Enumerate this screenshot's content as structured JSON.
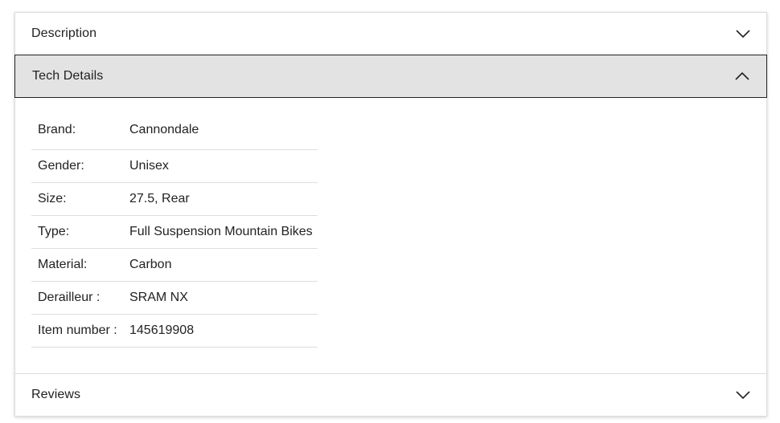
{
  "sections": {
    "description": {
      "title": "Description",
      "expanded": false,
      "icon": "chevron-down-icon"
    },
    "tech_details": {
      "title": "Tech Details",
      "expanded": true,
      "icon": "chevron-up-icon"
    },
    "reviews": {
      "title": "Reviews",
      "expanded": false,
      "icon": "chevron-down-icon"
    }
  },
  "tech_details": {
    "rows": [
      {
        "label": "Brand:",
        "value": "Cannondale"
      },
      {
        "label": "Gender:",
        "value": "Unisex"
      },
      {
        "label": "Size:",
        "value": "27.5, Rear"
      },
      {
        "label": "Type:",
        "value": "Full Suspension Mountain Bikes"
      },
      {
        "label": "Material:",
        "value": "Carbon"
      },
      {
        "label": "Derailleur :",
        "value": "SRAM NX"
      },
      {
        "label": "Item number :",
        "value": "145619908"
      }
    ]
  },
  "colors": {
    "open_header_bg": "#e3e3e3",
    "text": "#222222",
    "divider": "#dcdcdc"
  }
}
